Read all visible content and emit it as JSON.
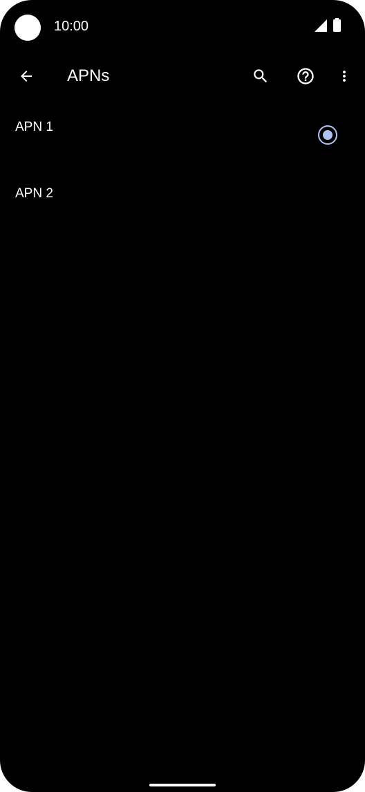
{
  "status_bar": {
    "time": "10:00",
    "icons": [
      "camera-cutout",
      "cellular-signal-icon",
      "battery-icon"
    ]
  },
  "app_bar": {
    "title": "APNs",
    "actions": [
      "back-arrow-icon",
      "search-icon",
      "help-icon",
      "more-vert-icon"
    ]
  },
  "apn_list": {
    "items": [
      {
        "label": "APN 1",
        "selected": true
      },
      {
        "label": "APN 2",
        "selected": false
      }
    ]
  },
  "colors": {
    "background": "#000000",
    "text": "#ffffff",
    "accent": "#aec3f4"
  }
}
